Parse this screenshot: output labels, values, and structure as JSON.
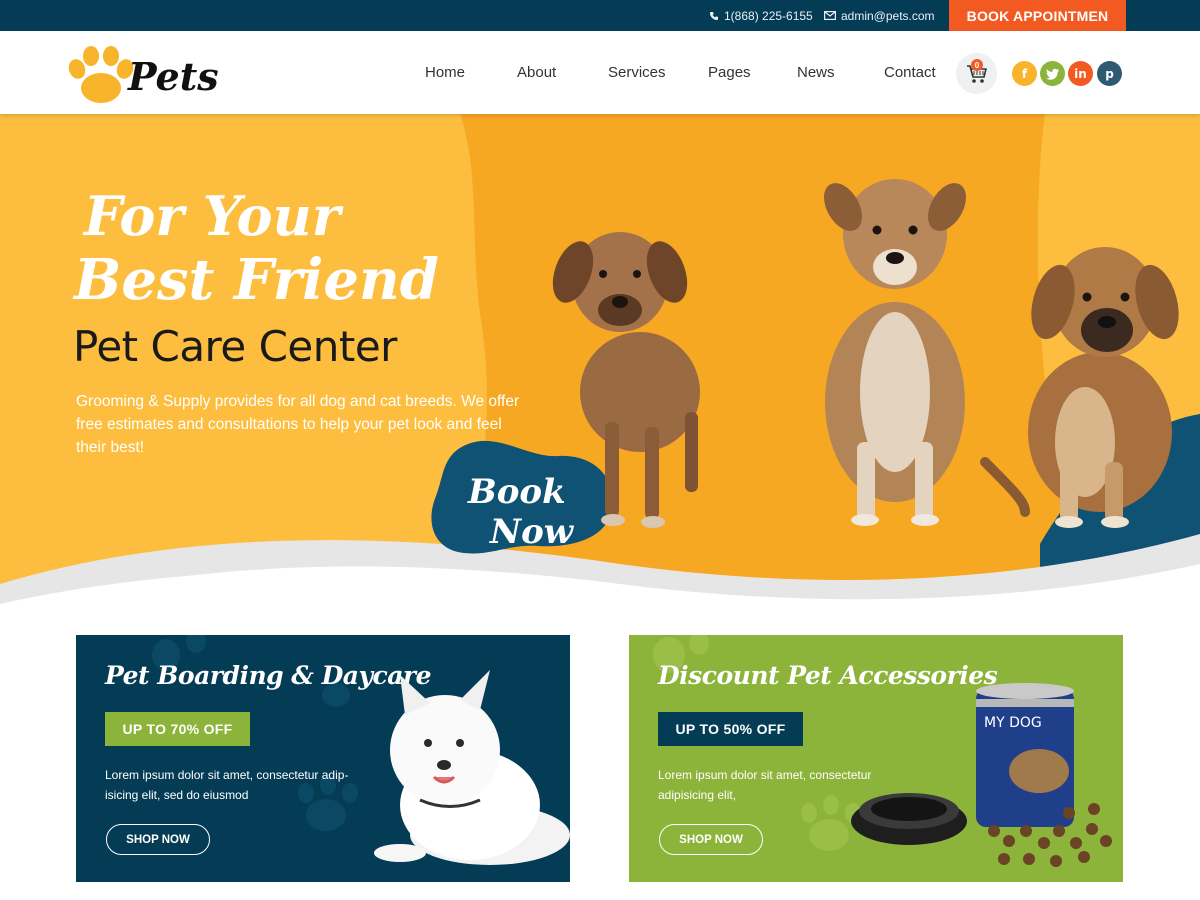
{
  "topbar": {
    "phone": "1(868) 225-6155",
    "email": "admin@pets.com",
    "book_button": "BOOK APPOINTMEN",
    "accent": "#f25a22",
    "background": "#053c55"
  },
  "header": {
    "logo_text": "Pets",
    "nav": [
      "Home",
      "About",
      "Services",
      "Pages",
      "News",
      "Contact"
    ],
    "cart_count": "0",
    "social": [
      {
        "icon": "facebook-icon",
        "glyph": "f",
        "color": "#f8b42a"
      },
      {
        "icon": "twitter-icon",
        "glyph": "t",
        "color": "#8cb33a"
      },
      {
        "icon": "linkedin-icon",
        "glyph": "in",
        "color": "#f25a22"
      },
      {
        "icon": "pinterest-icon",
        "glyph": "p",
        "color": "#2f5a74"
      }
    ]
  },
  "hero": {
    "script_line1": "For Your",
    "script_line2": "Best Friend",
    "title": "Pet Care Center",
    "description": "Grooming & Supply provides for all dog and cat breeds. We offer free estimates and consultations to help your pet look and feel their best!",
    "book_now_line1": "Book",
    "book_now_line2": "Now",
    "colors": {
      "yellow": "#fdbe3f",
      "orange": "#f7a823",
      "navy": "#0f5273"
    }
  },
  "promos": [
    {
      "title": "Pet Boarding & Daycare",
      "badge": "UP TO 70% OFF",
      "description": "Lorem ipsum dolor sit amet, consectetur adip-isicing elit, sed do eiusmod",
      "button": "SHOP NOW",
      "background": "#053c55",
      "badge_color": "#8cb33a"
    },
    {
      "title": "Discount Pet Accessories",
      "badge": "UP TO 50% OFF",
      "description": "Lorem ipsum dolor sit amet, consectetur adipisicing elit,",
      "button": "SHOP NOW",
      "background": "#8cb33a",
      "badge_color": "#053c55",
      "can_label": "MY DOG"
    }
  ]
}
